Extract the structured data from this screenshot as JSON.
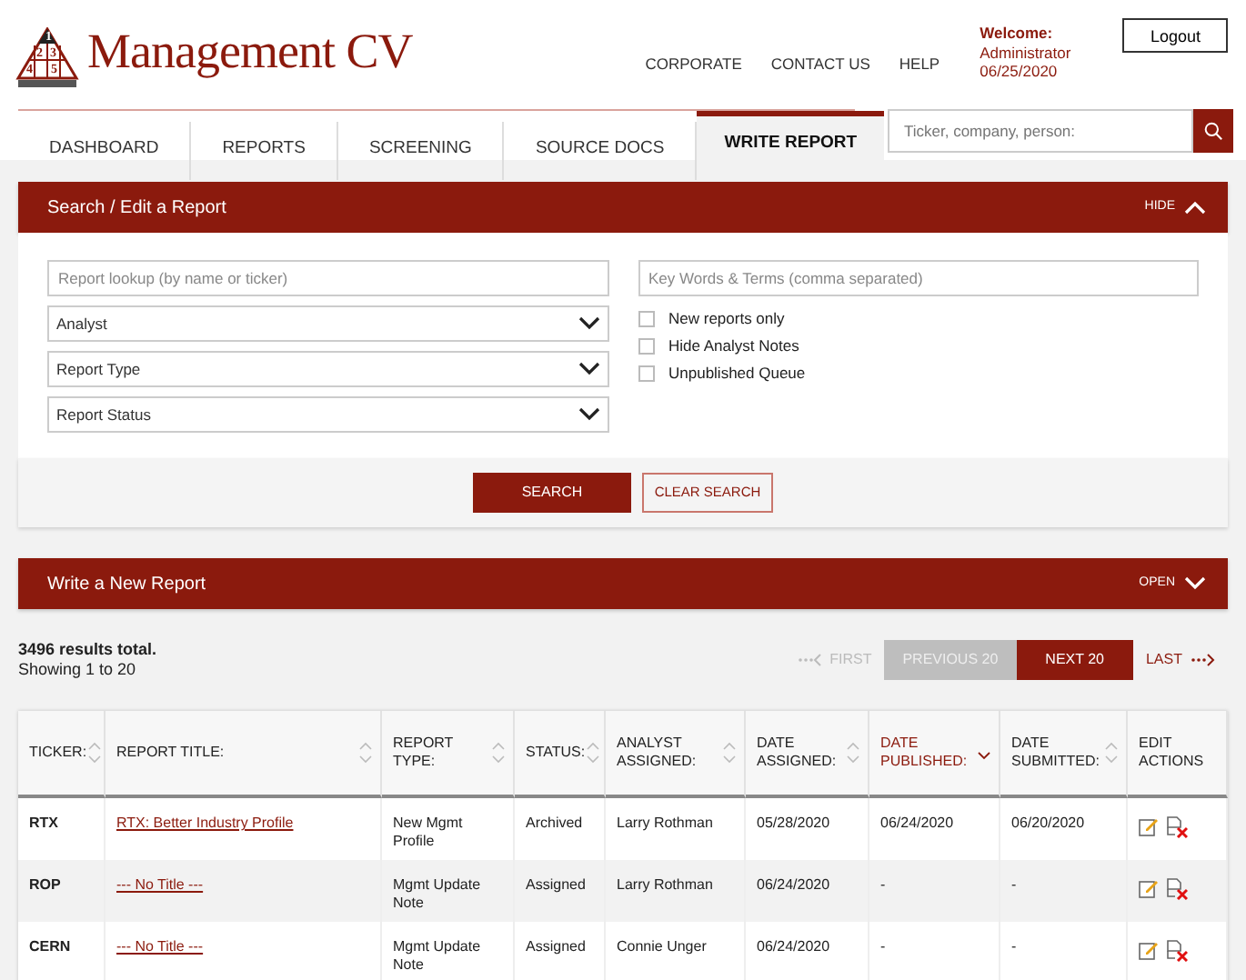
{
  "logo": {
    "marks": [
      "1",
      "2",
      "3",
      "4",
      "5"
    ],
    "name": "Management CV"
  },
  "top_links": [
    "CORPORATE",
    "CONTACT US",
    "HELP"
  ],
  "user": {
    "welcome": "Welcome:",
    "name": "Administrator",
    "date": "06/25/2020"
  },
  "logout": "Logout",
  "tabs": [
    {
      "label": "DASHBOARD",
      "selected": false
    },
    {
      "label": "REPORTS",
      "selected": false
    },
    {
      "label": "SCREENING",
      "selected": false
    },
    {
      "label": "SOURCE DOCS",
      "selected": false
    },
    {
      "label": "WRITE REPORT",
      "selected": true
    }
  ],
  "site_search": {
    "placeholder": "Ticker, company, person:"
  },
  "search_panel": {
    "title": "Search / Edit a Report",
    "toggle": "HIDE",
    "expanded": true,
    "lookup": {
      "placeholder": "Report lookup (by name or ticker)"
    },
    "keywords": {
      "placeholder": "Key Words & Terms (comma separated)"
    },
    "selects": [
      "Analyst",
      "Report Type",
      "Report Status"
    ],
    "checkboxes": [
      {
        "label": "New reports only",
        "checked": false
      },
      {
        "label": "Hide Analyst Notes",
        "checked": false
      },
      {
        "label": "Unpublished Queue",
        "checked": false
      }
    ],
    "search_button": "SEARCH",
    "clear_button": "CLEAR SEARCH"
  },
  "write_panel": {
    "title": "Write a New Report",
    "toggle": "OPEN",
    "expanded": false
  },
  "results": {
    "total": "3496 results total.",
    "showing": "Showing 1 to 20"
  },
  "pager": [
    {
      "label": "FIRST",
      "kind": "first",
      "disabled": true
    },
    {
      "label": "PREVIOUS 20",
      "kind": "prev",
      "disabled": true
    },
    {
      "label": "NEXT 20",
      "kind": "next",
      "disabled": false
    },
    {
      "label": "LAST",
      "kind": "last",
      "disabled": false
    }
  ],
  "table": {
    "columns": [
      {
        "label": "TICKER:",
        "sortable": true,
        "sorted": false
      },
      {
        "label": "REPORT TITLE:",
        "sortable": true,
        "sorted": false
      },
      {
        "label": "REPORT TYPE:",
        "sortable": true,
        "sorted": false
      },
      {
        "label": "STATUS:",
        "sortable": true,
        "sorted": false
      },
      {
        "label": "ANALYST ASSIGNED:",
        "sortable": true,
        "sorted": false
      },
      {
        "label": "DATE ASSIGNED:",
        "sortable": true,
        "sorted": false
      },
      {
        "label": "DATE PUBLISHED:",
        "sortable": true,
        "sorted": true
      },
      {
        "label": "DATE SUBMITTED:",
        "sortable": true,
        "sorted": false
      },
      {
        "label": "EDIT ACTIONS",
        "sortable": false,
        "sorted": false
      }
    ],
    "rows": [
      {
        "cells": [
          "RTX",
          "RTX: Better Industry Profile",
          "New Mgmt Profile",
          "Archived",
          "Larry Rothman",
          "05/28/2020",
          "06/24/2020",
          "06/20/2020"
        ]
      },
      {
        "cells": [
          "ROP",
          "--- No Title ---",
          "Mgmt Update Note",
          "Assigned",
          "Larry Rothman",
          "06/24/2020",
          "-",
          "-"
        ]
      },
      {
        "cells": [
          "CERN",
          "--- No Title ---",
          "Mgmt Update Note",
          "Assigned",
          "Connie Unger",
          "06/24/2020",
          "-",
          "-"
        ]
      }
    ]
  }
}
